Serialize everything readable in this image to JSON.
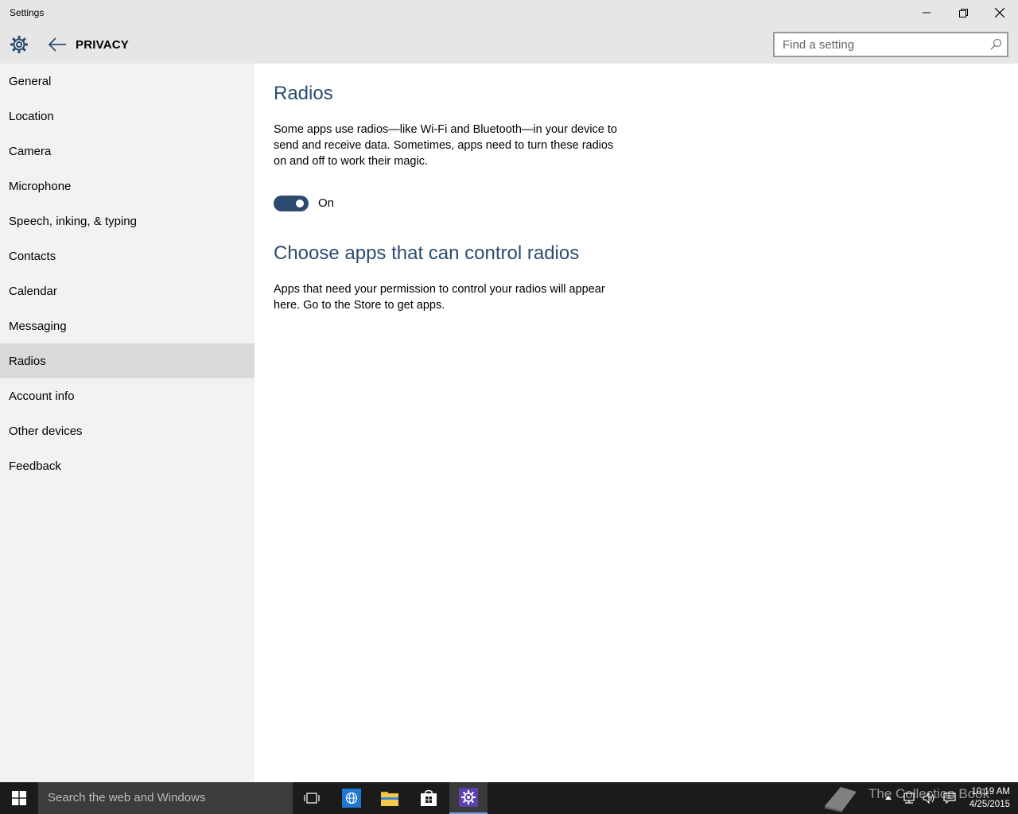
{
  "window": {
    "title": "Settings"
  },
  "header": {
    "section_title": "PRIVACY",
    "search_placeholder": "Find a setting"
  },
  "sidebar": {
    "items": [
      {
        "label": "General"
      },
      {
        "label": "Location"
      },
      {
        "label": "Camera"
      },
      {
        "label": "Microphone"
      },
      {
        "label": "Speech, inking, & typing"
      },
      {
        "label": "Contacts"
      },
      {
        "label": "Calendar"
      },
      {
        "label": "Messaging"
      },
      {
        "label": "Radios",
        "selected": true
      },
      {
        "label": "Account info"
      },
      {
        "label": "Other devices"
      },
      {
        "label": "Feedback"
      }
    ]
  },
  "main": {
    "heading": "Radios",
    "description_lines": [
      "Some apps use radios—like Wi-Fi and Bluetooth—in your device to",
      "send and receive data. Sometimes, apps need to turn these radios",
      "on and off to work their magic."
    ],
    "toggle": {
      "state": "On",
      "on": true
    },
    "subheading": "Choose apps that can control radios",
    "sub_description_lines": [
      "Apps that need your permission to control your radios will appear",
      "here. Go to the Store to get apps."
    ]
  },
  "taskbar": {
    "search_text": "Search the web and Windows",
    "watermark": "The Collection Book",
    "clock": {
      "time": "10:19 AM",
      "date": "4/25/2015"
    }
  },
  "colors": {
    "accent": "#2b4c6f",
    "sidebar_bg": "#f2f2f2",
    "selected_bg": "#d9d9d9",
    "titlebar_bg": "#e6e6e6",
    "taskbar_bg": "#1b1b1b"
  }
}
